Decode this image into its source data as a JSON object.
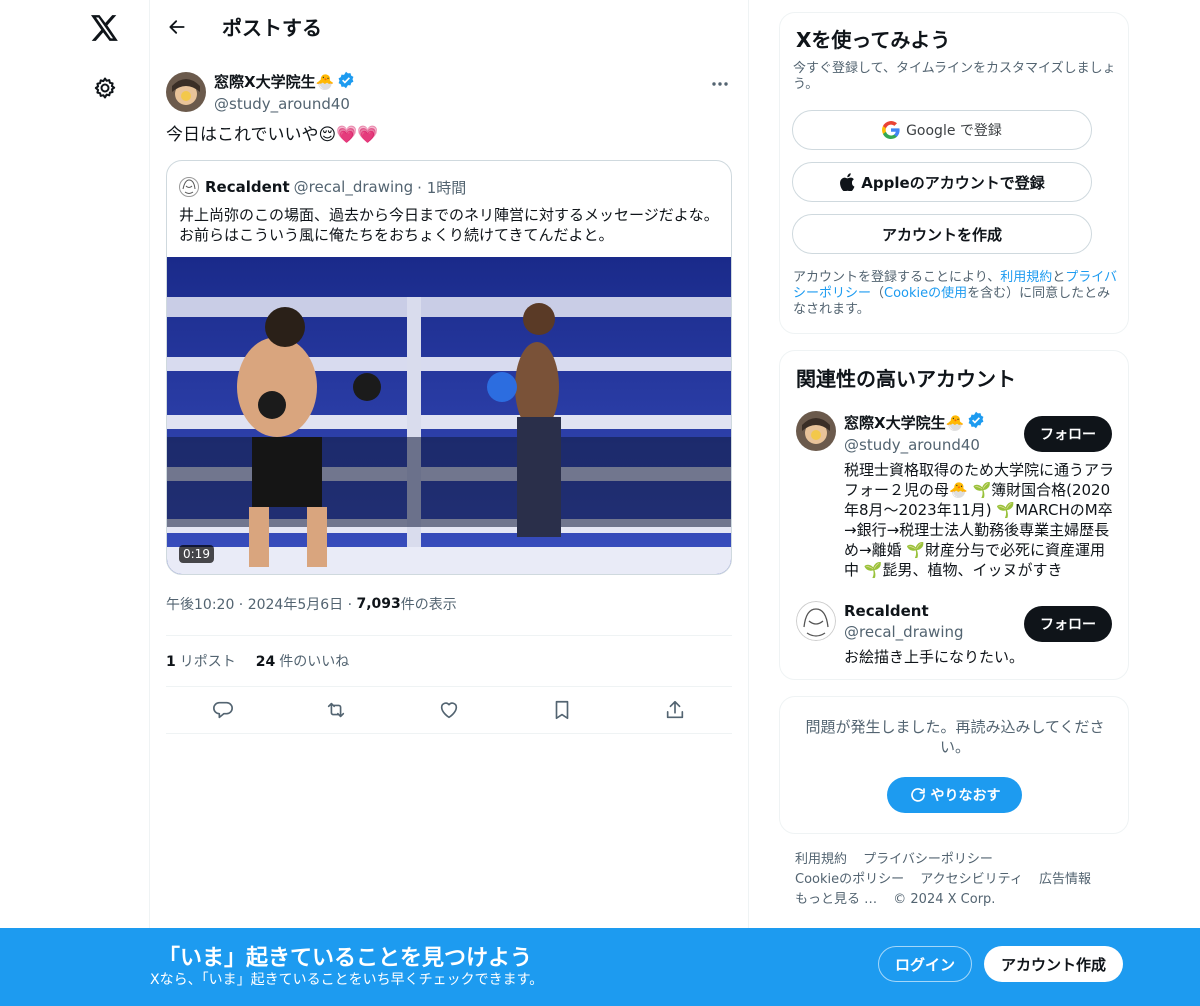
{
  "nav": {
    "logo": "x-logo-icon",
    "settings": "gear-icon"
  },
  "header": {
    "title": "ポストする"
  },
  "post": {
    "author_name": "窓際X大学院生🐣",
    "author_handle": "@study_around40",
    "text": "今日はこれでいいや😌💗💗",
    "quote": {
      "name": "Recaldent",
      "handle": "@recal_drawing",
      "time": "· 1時間",
      "text": "井上尚弥のこの場面、過去から今日までのネリ陣営に対するメッセージだよな。お前らはこういう風に俺たちをおちょくり続けてきてんだよと。",
      "video_duration": "0:19"
    },
    "timestamp": "午後10:20 · 2024年5月6日 · ",
    "views": "7,093",
    "views_label": " 件の表示",
    "reposts_count": "1",
    "reposts_label": "リポスト",
    "likes_count": "24",
    "likes_label": "件のいいね"
  },
  "signup_card": {
    "title": "Xを使ってみよう",
    "subtitle": "今すぐ登録して、タイムラインをカスタマイズしましょう。",
    "google_label": "Google で登録",
    "apple_label": "Appleのアカウントで登録",
    "create_label": "アカウントを作成",
    "terms_prefix": "アカウントを登録することにより、",
    "terms_link": "利用規約",
    "and": "と",
    "privacy_link": "プライバシーポリシー",
    "cookie_paren_open": "（",
    "cookie_link": "Cookieの使用",
    "terms_suffix": "を含む）に同意したとみなされます。"
  },
  "related": {
    "title": "関連性の高いアカウント",
    "follow_label": "フォロー",
    "accounts": [
      {
        "name": "窓際X大学院生🐣",
        "handle": "@study_around40",
        "bio": "税理士資格取得のため大学院に通うアラフォー２児の母🐣 🌱簿財国合格(2020年8月〜2023年11月) 🌱MARCHのM卒→銀行→税理士法人勤務後専業主婦歴長め→離婚 🌱財産分与で必死に資産運用中 🌱髭男、植物、イッヌがすき"
      },
      {
        "name": "Recaldent",
        "handle": "@recal_drawing",
        "bio": "お絵描き上手になりたい。"
      }
    ]
  },
  "error_card": {
    "message": "問題が発生しました。再読み込みしてください。",
    "retry_label": "やりなおす"
  },
  "footer": {
    "terms": "利用規約",
    "privacy": "プライバシーポリシー",
    "cookie": "Cookieのポリシー",
    "accessibility": "アクセシビリティ",
    "ads": "広告情報",
    "more": "もっと見る …",
    "copyright": "© 2024 X Corp."
  },
  "bottom_bar": {
    "title": "「いま」起きていることを見つけよう",
    "subtitle": "Xなら、「いま」起きていることをいち早くチェックできます。",
    "login_label": "ログイン",
    "signup_label": "アカウント作成"
  },
  "colors": {
    "accent": "#1d9bf0",
    "text": "#0f1419",
    "muted": "#536471",
    "verified": "#1d9bf0"
  }
}
